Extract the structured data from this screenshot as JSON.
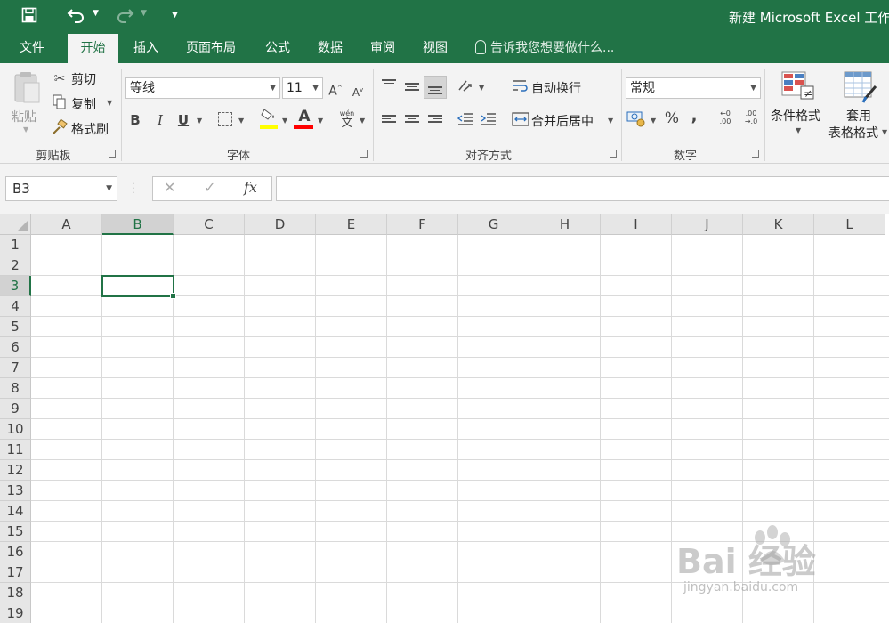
{
  "app": {
    "title": "新建 Microsoft Excel 工作"
  },
  "tabs": [
    {
      "label": "文件",
      "active": false
    },
    {
      "label": "开始",
      "active": true
    },
    {
      "label": "插入",
      "active": false
    },
    {
      "label": "页面布局",
      "active": false
    },
    {
      "label": "公式",
      "active": false
    },
    {
      "label": "数据",
      "active": false
    },
    {
      "label": "审阅",
      "active": false
    },
    {
      "label": "视图",
      "active": false
    }
  ],
  "tell_me": "告诉我您想要做什么...",
  "clipboard": {
    "paste_label": "粘贴",
    "cut_label": "剪切",
    "copy_label": "复制",
    "format_painter_label": "格式刷",
    "group_label": "剪贴板"
  },
  "font": {
    "font_name": "等线",
    "font_size": "11",
    "bold_label": "B",
    "italic_label": "I",
    "underline_label": "U",
    "font_color_label": "A",
    "phonetic_label": "wén",
    "phonetic_char": "文",
    "group_label": "字体",
    "highlight_color": "#ffff00",
    "font_color": "#ff0000"
  },
  "alignment": {
    "wrap_text_label": "自动换行",
    "merge_center_label": "合并后居中",
    "group_label": "对齐方式"
  },
  "number": {
    "format_value": "常规",
    "percent_label": "%",
    "comma_label": ",",
    "group_label": "数字"
  },
  "styles": {
    "conditional_format_label": "条件格式",
    "format_table_label_1": "套用",
    "format_table_label_2": "表格格式"
  },
  "formula_bar": {
    "name_box_value": "B3",
    "cancel_symbol": "✕",
    "enter_symbol": "✓",
    "fx_label": "fx",
    "formula_value": ""
  },
  "sheet": {
    "columns": [
      "A",
      "B",
      "C",
      "D",
      "E",
      "F",
      "G",
      "H",
      "I",
      "J",
      "K",
      "L"
    ],
    "rows": [
      "1",
      "2",
      "3",
      "4",
      "5",
      "6",
      "7",
      "8",
      "9",
      "10",
      "11",
      "12",
      "13",
      "14",
      "15",
      "16",
      "17",
      "18",
      "19"
    ],
    "selected_column": "B",
    "selected_row": "3"
  },
  "watermark": {
    "logo_text": "Bai 经验",
    "url": "jingyan.baidu.com"
  },
  "colors": {
    "accent": "#217346"
  }
}
